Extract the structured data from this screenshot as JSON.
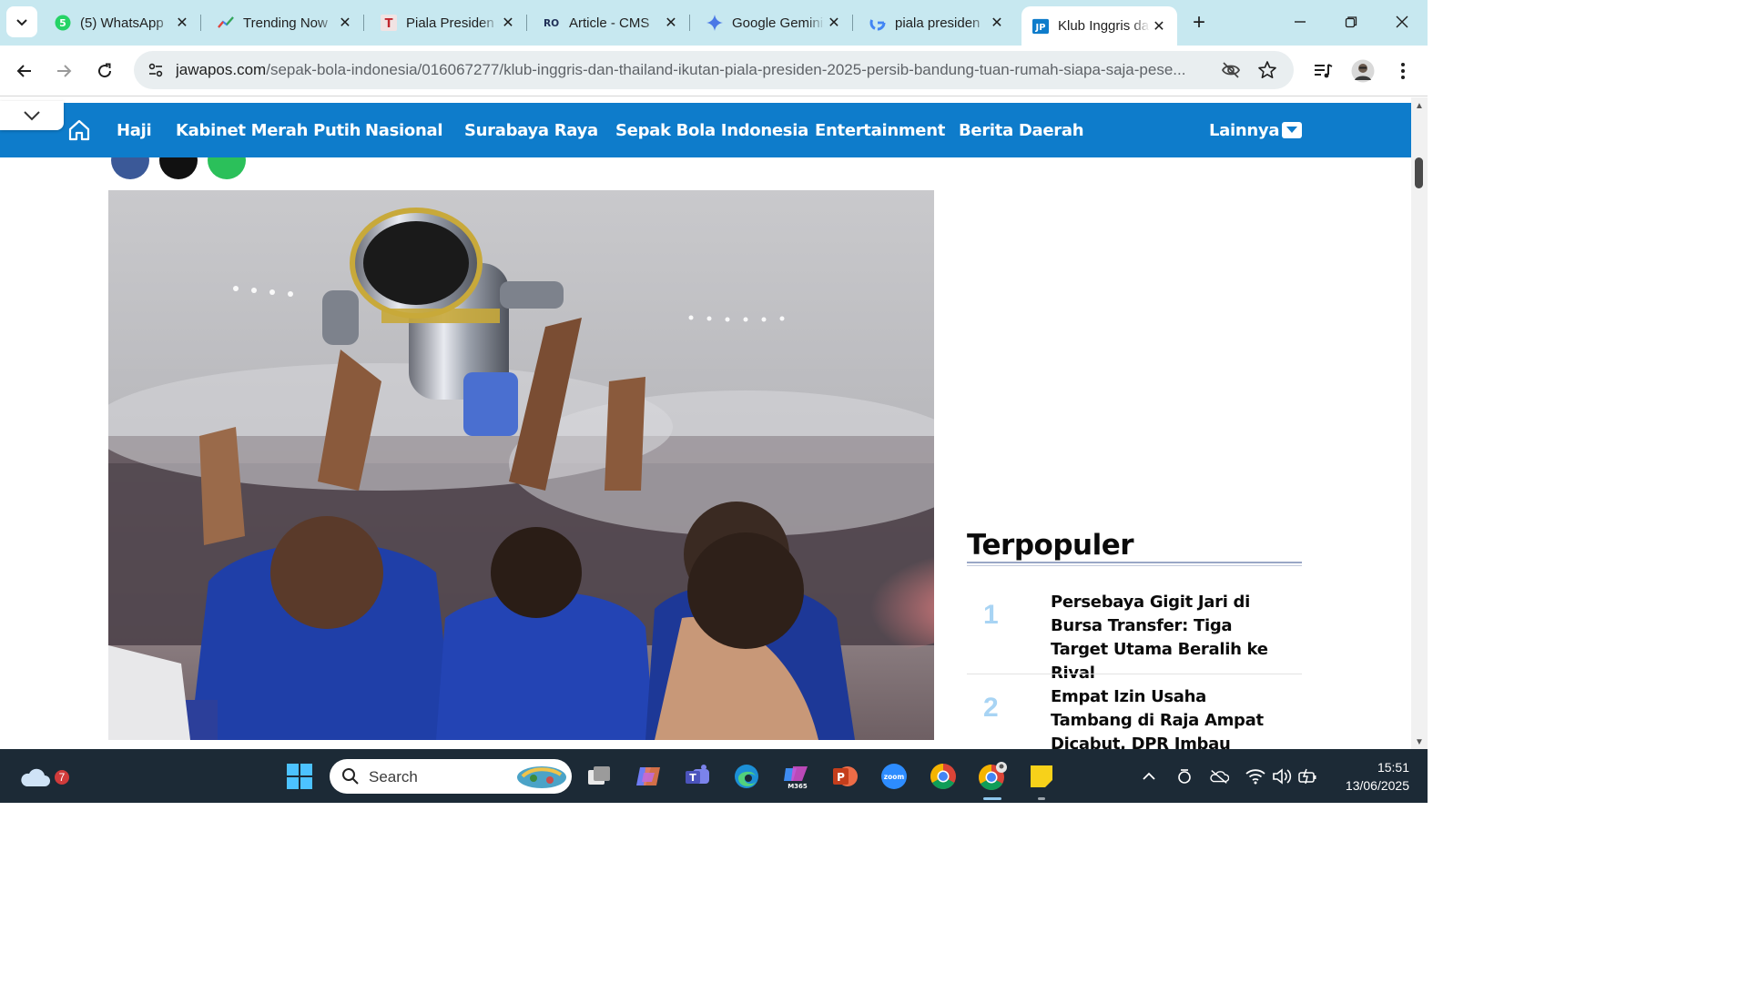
{
  "browser": {
    "tabs": [
      {
        "title": "(5) WhatsApp",
        "icon": "whatsapp-icon"
      },
      {
        "title": "Trending Now",
        "icon": "trends-icon"
      },
      {
        "title": "Piala Presiden",
        "icon": "t-logo-icon"
      },
      {
        "title": "Article - CMS",
        "icon": "cms-icon"
      },
      {
        "title": "Google Gemini",
        "icon": "gemini-icon"
      },
      {
        "title": "piala presiden",
        "icon": "google-icon"
      },
      {
        "title": "Klub Inggris dan Thailand",
        "icon": "jawapos-icon",
        "active": true
      }
    ],
    "url_host": "jawapos.com",
    "url_path": "/sepak-bola-indonesia/016067277/klub-inggris-dan-thailand-ikutan-piala-presiden-2025-persib-bandung-tuan-rumah-siapa-saja-pese..."
  },
  "site": {
    "nav_items": [
      "Haji",
      "Kabinet Merah Putih",
      "Nasional",
      "Surabaya Raya",
      "Sepak Bola Indonesia",
      "Entertainment",
      "Berita Daerah"
    ],
    "more_label": "Lainnya",
    "brand_color": "#0e7ccb"
  },
  "sidebar": {
    "popular_title": "Terpopuler",
    "popular": [
      {
        "rank": "1",
        "title": "Persebaya Gigit Jari di Bursa Transfer: Tiga Target Utama Beralih ke Rival"
      },
      {
        "rank": "2",
        "title": "Empat Izin Usaha Tambang di Raja Ampat Dicabut, DPR Imbau Pemerintah Konsiste..."
      }
    ]
  },
  "taskbar": {
    "search_label": "Search",
    "weather_badge": "7",
    "time": "15:51",
    "date": "13/06/2025"
  }
}
